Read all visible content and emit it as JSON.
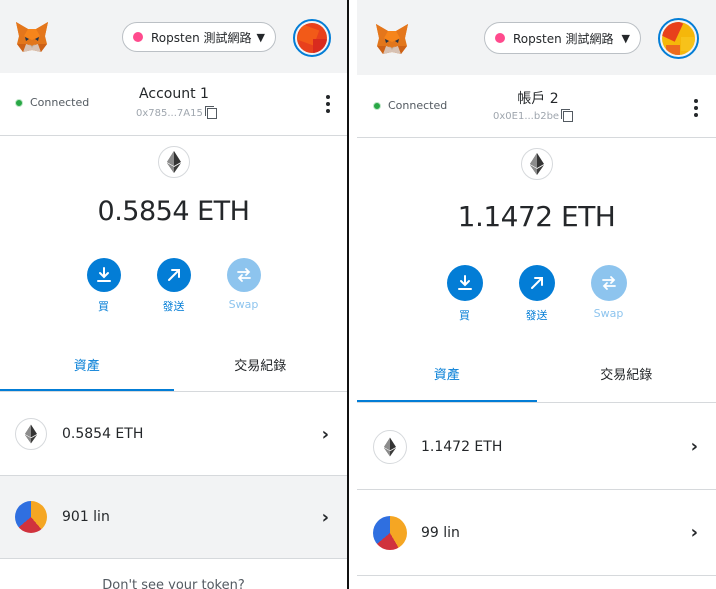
{
  "left": {
    "network": "Ropsten 測試網路",
    "status": "Connected",
    "account_name": "Account 1",
    "account_address": "0x785...7A15",
    "balance": "0.5854 ETH",
    "actions": [
      {
        "label": "買",
        "icon": "download-icon"
      },
      {
        "label": "發送",
        "icon": "arrow-up-right-icon"
      },
      {
        "label": "Swap",
        "icon": "swap-icon"
      }
    ],
    "tabs": [
      {
        "label": "資產"
      },
      {
        "label": "交易紀錄"
      }
    ],
    "assets": [
      {
        "label": "0.5854 ETH",
        "icon": "ethereum-icon"
      },
      {
        "label": "901 lin",
        "icon": "token-identicon"
      }
    ],
    "bottom_hint": "Don't see your token?"
  },
  "right": {
    "network": "Ropsten 測試網路",
    "status": "Connected",
    "account_name": "帳戶 2",
    "account_address": "0x0E1...b2be",
    "balance": "1.1472 ETH",
    "actions": [
      {
        "label": "買",
        "icon": "download-icon"
      },
      {
        "label": "發送",
        "icon": "arrow-up-right-icon"
      },
      {
        "label": "Swap",
        "icon": "swap-icon"
      }
    ],
    "tabs": [
      {
        "label": "資產"
      },
      {
        "label": "交易紀錄"
      }
    ],
    "assets": [
      {
        "label": "1.1472 ETH",
        "icon": "ethereum-icon"
      },
      {
        "label": "99 lin",
        "icon": "token-identicon"
      }
    ]
  },
  "colors": {
    "accent": "#037dd6",
    "accent_disabled": "#8dc4ee",
    "network_dot": "#ff4a8d",
    "connected_dot": "#28a745"
  }
}
